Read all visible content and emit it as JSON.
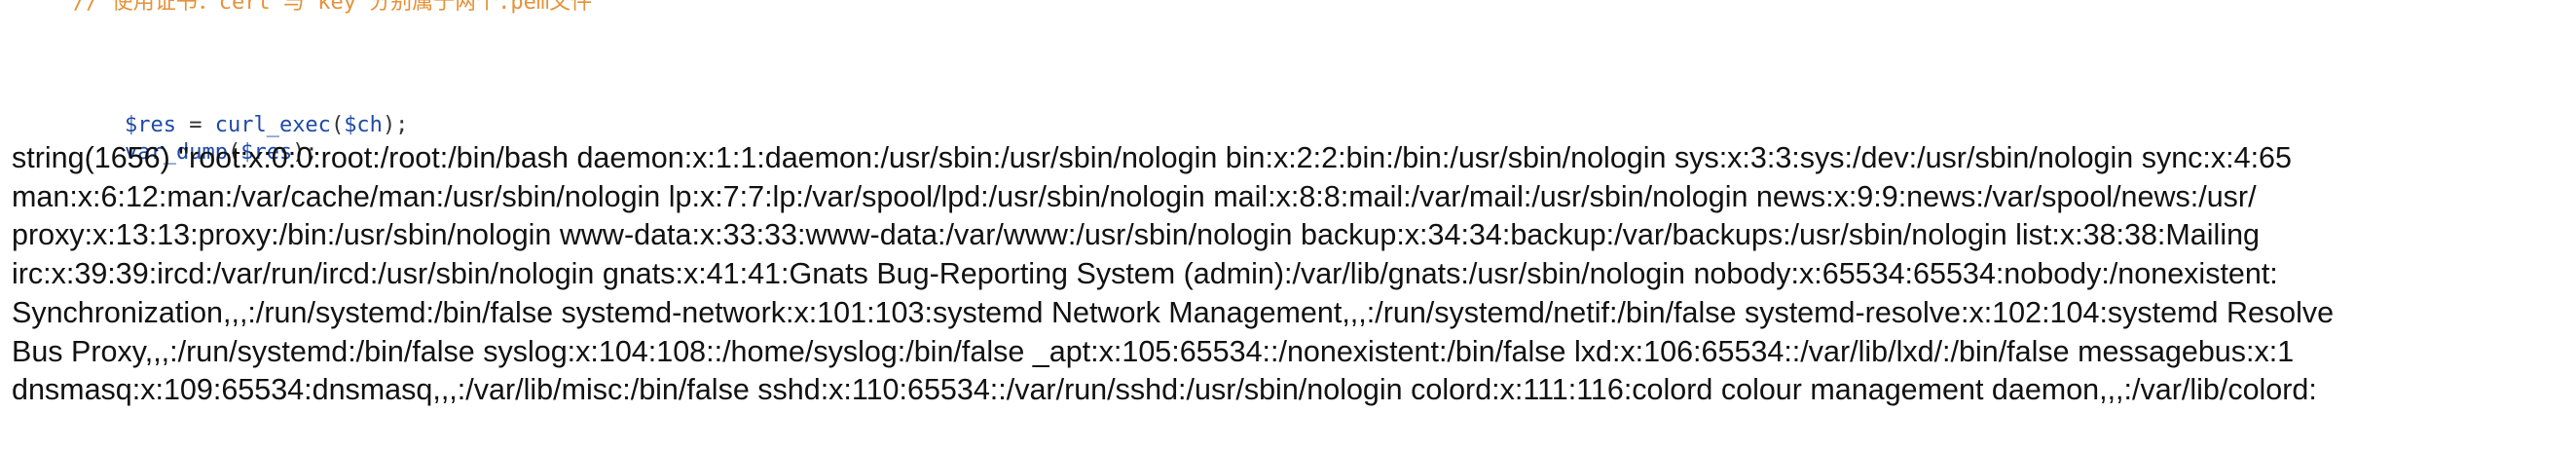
{
  "code": {
    "comment": "// 使用证书：cert 与 key 分别属于两个.pem文件",
    "line_res": {
      "var": "$res",
      "assign": " = ",
      "fn": "curl_exec",
      "open": "(",
      "arg": "$ch",
      "close": ");"
    },
    "line_dump": {
      "fn": "var_dump",
      "open": "(",
      "arg": "$res",
      "close": ");"
    }
  },
  "output": {
    "lines": [
      "string(1656) \"root:x:0:0:root:/root:/bin/bash daemon:x:1:1:daemon:/usr/sbin:/usr/sbin/nologin bin:x:2:2:bin:/bin:/usr/sbin/nologin sys:x:3:3:sys:/dev:/usr/sbin/nologin sync:x:4:65",
      "man:x:6:12:man:/var/cache/man:/usr/sbin/nologin lp:x:7:7:lp:/var/spool/lpd:/usr/sbin/nologin mail:x:8:8:mail:/var/mail:/usr/sbin/nologin news:x:9:9:news:/var/spool/news:/usr/",
      "proxy:x:13:13:proxy:/bin:/usr/sbin/nologin www-data:x:33:33:www-data:/var/www:/usr/sbin/nologin backup:x:34:34:backup:/var/backups:/usr/sbin/nologin list:x:38:38:Mailing",
      "irc:x:39:39:ircd:/var/run/ircd:/usr/sbin/nologin gnats:x:41:41:Gnats Bug-Reporting System (admin):/var/lib/gnats:/usr/sbin/nologin nobody:x:65534:65534:nobody:/nonexistent:",
      "Synchronization,,,:/run/systemd:/bin/false systemd-network:x:101:103:systemd Network Management,,,:/run/systemd/netif:/bin/false systemd-resolve:x:102:104:systemd Resolve",
      "Bus Proxy,,,:/run/systemd:/bin/false syslog:x:104:108::/home/syslog:/bin/false _apt:x:105:65534::/nonexistent:/bin/false lxd:x:106:65534::/var/lib/lxd/:/bin/false messagebus:x:1",
      "dnsmasq:x:109:65534:dnsmasq,,,:/var/lib/misc:/bin/false sshd:x:110:65534::/var/run/sshd:/usr/sbin/nologin colord:x:111:116:colord colour management daemon,,,:/var/lib/colord:"
    ]
  }
}
